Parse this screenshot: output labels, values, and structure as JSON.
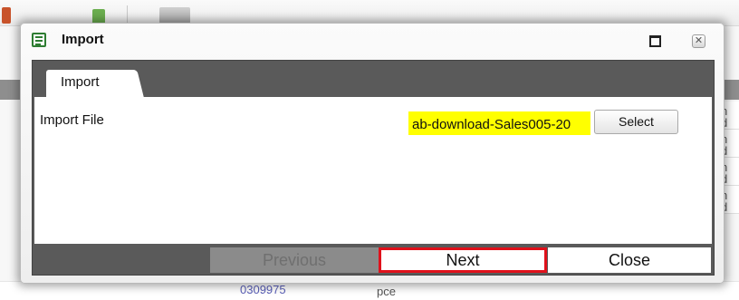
{
  "background": {
    "rows_fragment": [
      "n\nd",
      "n\nd",
      "n\nd",
      "n\nd"
    ],
    "bottom_link": "0309975",
    "bottom_unit": "pce"
  },
  "dialog": {
    "title": "Import",
    "title_icon": "list-document-icon",
    "maximize_icon": "maximize-icon",
    "close_icon": "close-icon",
    "close_glyph": "✕",
    "tab_label": "Import",
    "import_file_label": "Import File",
    "import_file_value": "ab-download-Sales005-20",
    "select_label": "Select",
    "buttons": {
      "previous": "Previous",
      "next": "Next",
      "close": "Close"
    },
    "highlight_color": "#ffff00",
    "focus_outline_color": "#e0111b"
  }
}
